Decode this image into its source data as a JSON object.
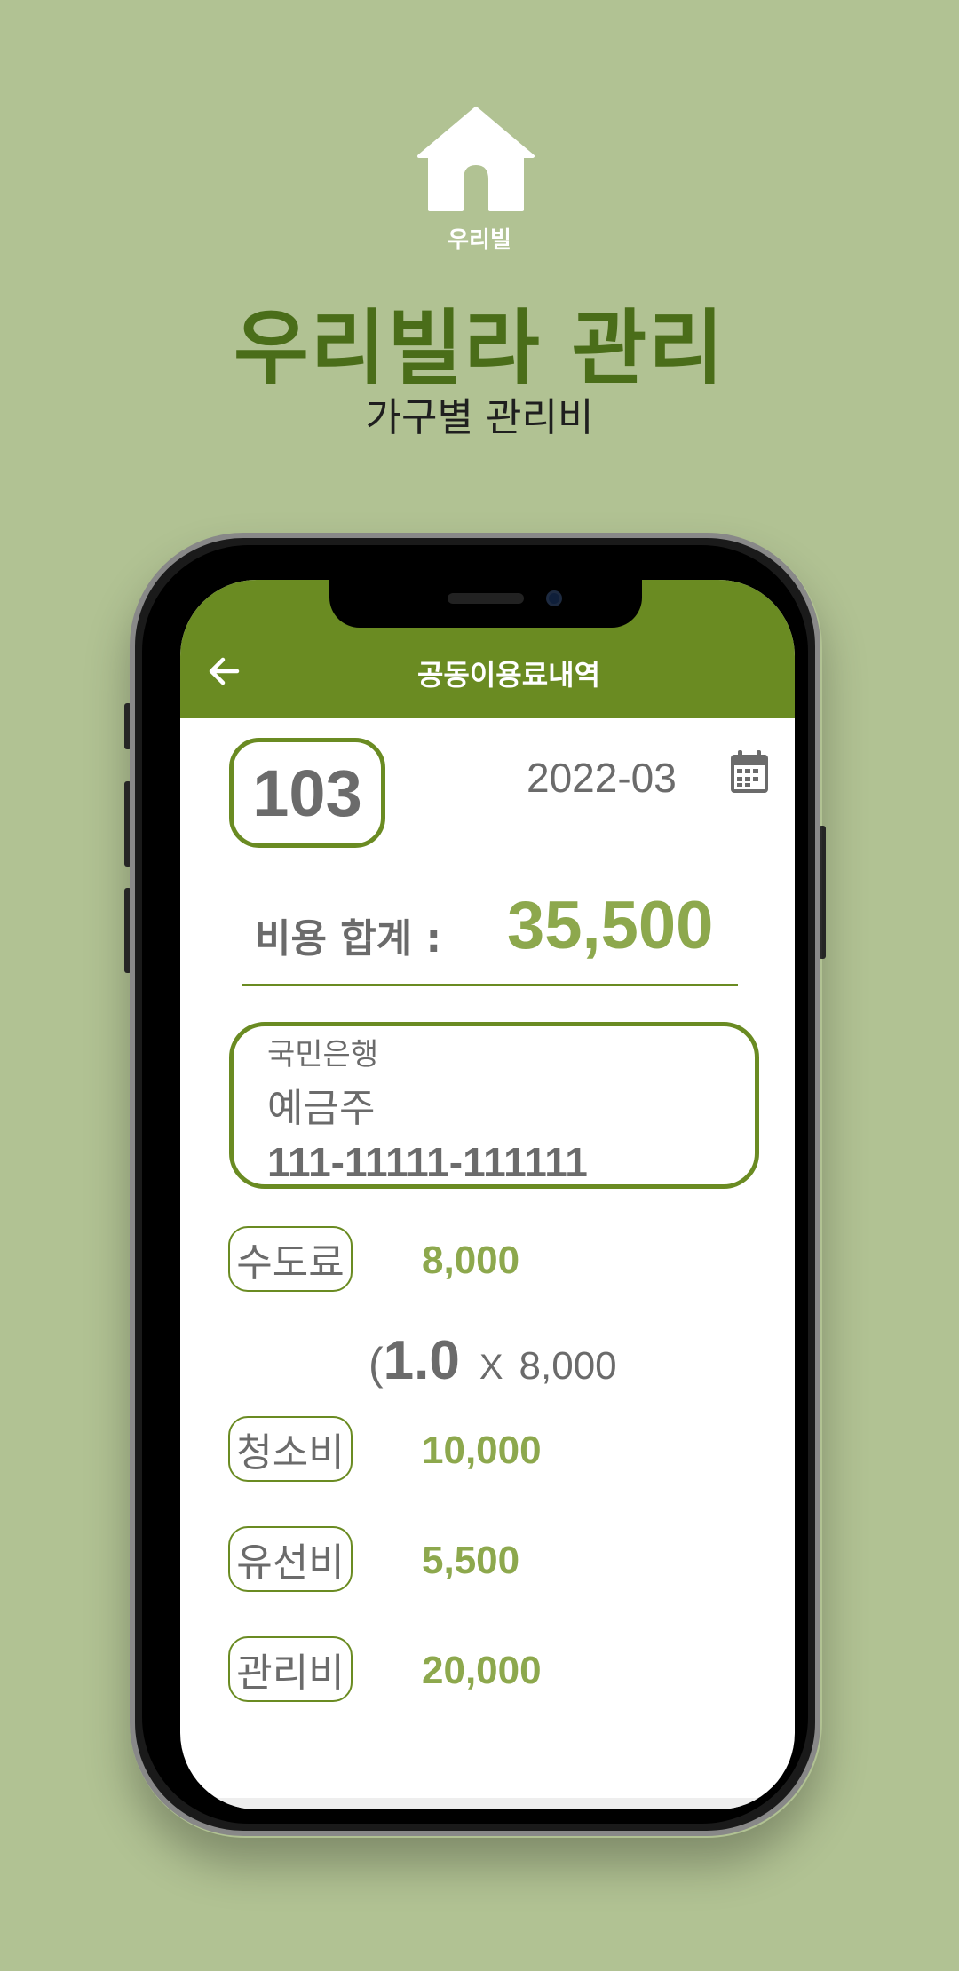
{
  "brand": {
    "logo_text": "우리빌",
    "headline": "우리빌라 관리",
    "subline": "가구별 관리비"
  },
  "colors": {
    "background": "#b1c293",
    "primary": "#6a8b22",
    "accent_text": "#8da84d",
    "headline": "#4a6d19",
    "body_text": "#6b6b6b"
  },
  "app": {
    "title": "공동이용료내역",
    "back_icon": "arrow-left-icon",
    "unit_number": "103",
    "month": "2022-03",
    "calendar_icon": "calendar-icon",
    "total": {
      "label": "비용 합계 :",
      "value": "35,500"
    },
    "bank": {
      "name": "국민은행",
      "holder": "예금주",
      "account": "111-11111-111111"
    },
    "fees": [
      {
        "label": "수도료",
        "amount": "8,000"
      },
      {
        "label": "청소비",
        "amount": "10,000"
      },
      {
        "label": "유선비",
        "amount": "5,500"
      },
      {
        "label": "관리비",
        "amount": "20,000"
      }
    ],
    "water_formula": {
      "open": "(",
      "quantity": "1.0",
      "times": "X",
      "rate": "8,000"
    }
  }
}
